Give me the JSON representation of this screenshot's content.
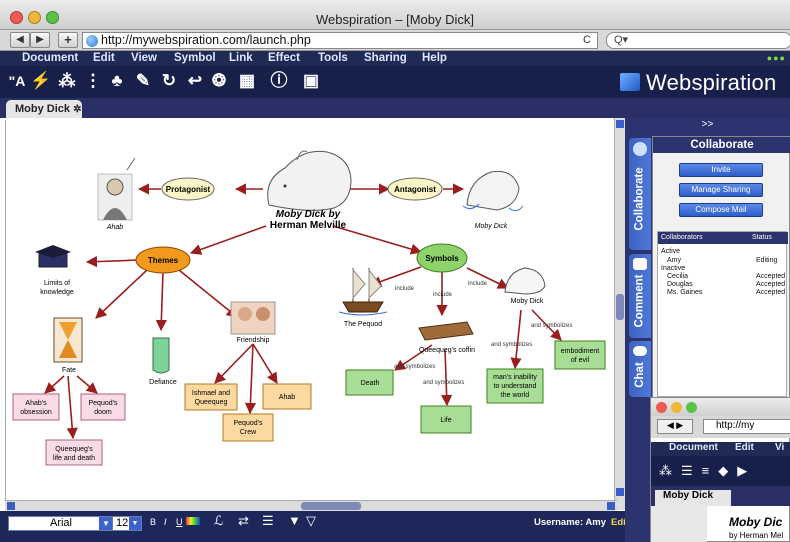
{
  "window": {
    "title": "Webspiration – [Moby Dick]"
  },
  "address": {
    "url": "http://mywebspiration.com/launch.php",
    "search_placeholder": "Q▾",
    "reload": "C"
  },
  "menu": [
    "Document",
    "Edit",
    "View",
    "Symbol",
    "Link",
    "Effect",
    "Tools",
    "Sharing",
    "Help"
  ],
  "toolbar": {
    "logo": "Webspiration",
    "icons": [
      "text-size-icon",
      "rapid-fire-icon",
      "create-icon",
      "outline-icon",
      "arrange-icon",
      "note-icon",
      "link-icon",
      "undo-icon",
      "symbols-icon",
      "layout-icon",
      "info-icon",
      "view-icon"
    ]
  },
  "tabs": {
    "document": "Moby Dick"
  },
  "diagram": {
    "main_title": "Moby Dick by",
    "main_subtitle": "Herman Melville",
    "nodes": {
      "protagonist": "Protagonist",
      "antagonist": "Antagonist",
      "themes": "Themes",
      "symbols": "Symbols",
      "ahab_caption": "Ahab",
      "mobydick_caption": "Moby Dick",
      "limits_1": "Limits of",
      "limits_2": "knowledge",
      "fate": "Fate",
      "defiance": "Defiance",
      "friendship": "Friendship",
      "ahabs_obsession_1": "Ahab's",
      "ahabs_obsession_2": "obsession",
      "pequods_doom_1": "Pequod's",
      "pequods_doom_2": "doom",
      "queequegs_life_1": "Queequeg's",
      "queequegs_life_2": "life and death",
      "ishmael_1": "Ishmael and",
      "ishmael_2": "Queequeg",
      "ahab_box": "Ahab",
      "pequods_crew_1": "Pequod's",
      "pequods_crew_2": "Crew",
      "pequod": "The Pequod",
      "coffin": "Queequeg's coffin",
      "moby_dick_symbol": "Moby Dick",
      "death": "Death",
      "life": "Life",
      "inability_1": "man's inability",
      "inability_2": "to understand",
      "inability_3": "the world",
      "evil_1": "embodiment",
      "evil_2": "of evil"
    },
    "link_labels": {
      "include": "include",
      "and_symbolizes": "and symbolizes"
    }
  },
  "collaborate": {
    "panel_toggle": ">>",
    "title": "Collaborate",
    "buttons": [
      "Invite",
      "Manage Sharing",
      "Compose Mail"
    ],
    "columns": [
      "Collaborators",
      "Status"
    ],
    "groups": [
      {
        "label": "Active",
        "rows": [
          {
            "name": "Amy",
            "status": "Editing"
          }
        ]
      },
      {
        "label": "Inactive",
        "rows": [
          {
            "name": "Cecilia",
            "status": "Accepted"
          },
          {
            "name": "Douglas",
            "status": "Accepted"
          },
          {
            "name": "Ms. Gaines",
            "status": "Accepted"
          }
        ]
      }
    ],
    "side_tabs": [
      "Collaborate",
      "Comment",
      "Chat"
    ]
  },
  "format": {
    "font": "Arial",
    "size": "12",
    "bold": "B",
    "italic": "I",
    "underline": "U"
  },
  "status": {
    "user": "Username: Amy",
    "editing": "Editing: "
  },
  "sub_window": {
    "url": "http://my",
    "menu": [
      "Document",
      "Edit",
      "Vi"
    ],
    "tab": "Moby Dick",
    "title": "Moby Dic",
    "byline": "by Herman Mel"
  },
  "colors": {
    "menubar": "#1f2a55",
    "accent_blue": "#3d63c2",
    "themes_orange": "#f39a1e",
    "symbols_green": "#8fd16a",
    "link_red": "#9b1e1e"
  }
}
